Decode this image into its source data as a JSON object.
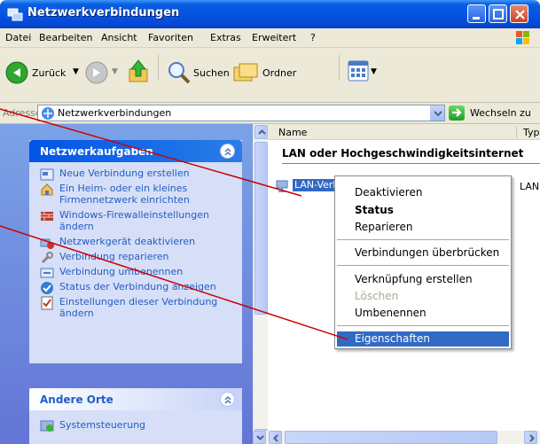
{
  "window": {
    "title": "Netzwerkverbindungen"
  },
  "menu": [
    "Datei",
    "Bearbeiten",
    "Ansicht",
    "Favoriten",
    "Extras",
    "Erweitert",
    "?"
  ],
  "toolbar": {
    "back": "Zurück",
    "search": "Suchen",
    "folders": "Ordner"
  },
  "address": {
    "label": "Adresse",
    "value": "Netzwerkverbindungen",
    "go": "Wechseln zu"
  },
  "tasks_panel": {
    "title": "Netzwerkaufgaben",
    "items": [
      "Neue Verbindung erstellen",
      "Ein Heim- oder ein kleines Firmennetzwerk einrichten",
      "Windows-Firewalleinstellungen ändern",
      "Netzwerkgerät deaktivieren",
      "Verbindung reparieren",
      "Verbindung umbenennen",
      "Status der Verbindung anzeigen",
      "Einstellungen dieser Verbindung ändern"
    ]
  },
  "places_panel": {
    "title": "Andere Orte",
    "items": [
      "Systemsteuerung"
    ]
  },
  "list": {
    "columns": [
      "Name",
      "Typ"
    ],
    "group": "LAN oder Hochgeschwindigkeitsinternet",
    "item_name": "LAN-Verb",
    "item_type": "LAN"
  },
  "context_menu": {
    "items": [
      "Deaktivieren",
      "Status",
      "Reparieren",
      "Verbindungen überbrücken",
      "Verknüpfung erstellen",
      "Löschen",
      "Umbenennen",
      "Eigenschaften"
    ],
    "bold": "Status",
    "disabled": "Löschen",
    "selected": "Eigenschaften"
  },
  "colors": {
    "annotation_line": "#cc0000",
    "selection": "#316ac5",
    "task_text": "#215dc6"
  }
}
